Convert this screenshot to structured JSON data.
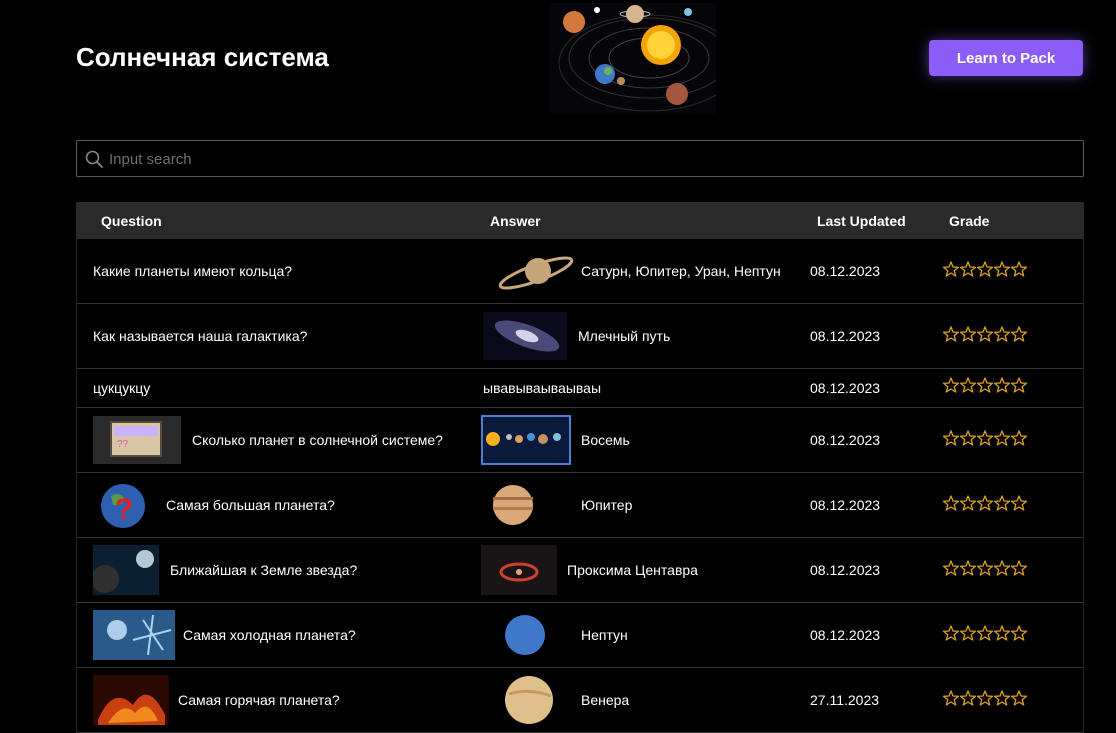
{
  "page": {
    "title": "Солнечная система",
    "learn_button": "Learn to Pack"
  },
  "search": {
    "placeholder": "Input search"
  },
  "table": {
    "headers": {
      "question": "Question",
      "answer": "Answer",
      "updated": "Last Updated",
      "grade": "Grade"
    },
    "rows": [
      {
        "question": "Какие планеты имеют кольца?",
        "answer": "Сатурн, Юпитер, Уран, Нептун",
        "date": "08.12.2023",
        "stars": 0
      },
      {
        "question": "Как называется наша галактика?",
        "answer": "Млечный путь",
        "date": "08.12.2023",
        "stars": 0
      },
      {
        "question": "цукцукцу",
        "answer": "ывавываываываы",
        "date": "08.12.2023",
        "stars": 0
      },
      {
        "question": "Сколько планет в солнечной системе?",
        "answer": "Восемь",
        "date": "08.12.2023",
        "stars": 0
      },
      {
        "question": "Самая большая планета?",
        "answer": "Юпитер",
        "date": "08.12.2023",
        "stars": 0
      },
      {
        "question": "Ближайшая к Земле звезда?",
        "answer": "Проксима Центавра",
        "date": "08.12.2023",
        "stars": 0
      },
      {
        "question": "Самая холодная планета?",
        "answer": "Нептун",
        "date": "08.12.2023",
        "stars": 0
      },
      {
        "question": "Самая горячая планета?",
        "answer": "Венера",
        "date": "27.11.2023",
        "stars": 0
      }
    ]
  },
  "colors": {
    "accent": "#8b5cf6",
    "star": "#e0a020",
    "header_bg": "#2a2a2a"
  }
}
